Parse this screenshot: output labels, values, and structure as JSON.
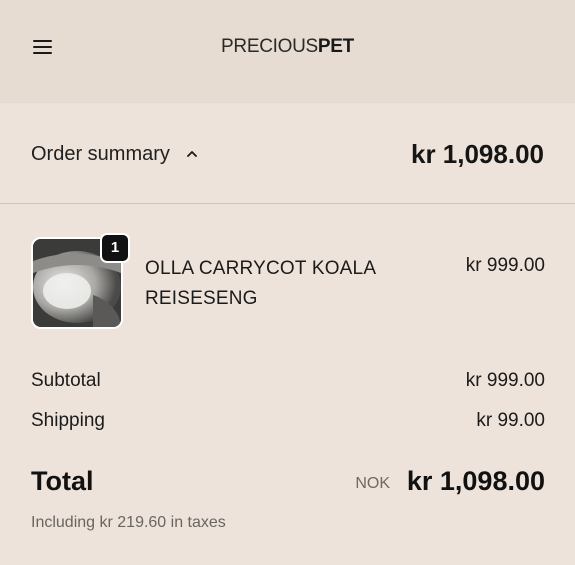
{
  "header": {
    "logo_thin": "PRECIOUS",
    "logo_bold": "PET",
    "menu_icon": "hamburger-menu-icon"
  },
  "order_summary": {
    "label": "Order summary",
    "toggle_icon": "chevron-up-icon",
    "total": "kr 1,098.00"
  },
  "line_items": [
    {
      "quantity": "1",
      "name": "OLLA CARRYCOT KOALA REISESENG",
      "price": "kr 999.00"
    }
  ],
  "costs": {
    "subtotal_label": "Subtotal",
    "subtotal_value": "kr 999.00",
    "shipping_label": "Shipping",
    "shipping_value": "kr 99.00"
  },
  "total": {
    "label": "Total",
    "currency": "NOK",
    "amount": "kr 1,098.00",
    "taxes_note": "Including kr 219.60 in taxes"
  },
  "colors": {
    "page_background": "#ede3da",
    "header_background": "#e6dcd2",
    "badge_background": "#111111"
  }
}
